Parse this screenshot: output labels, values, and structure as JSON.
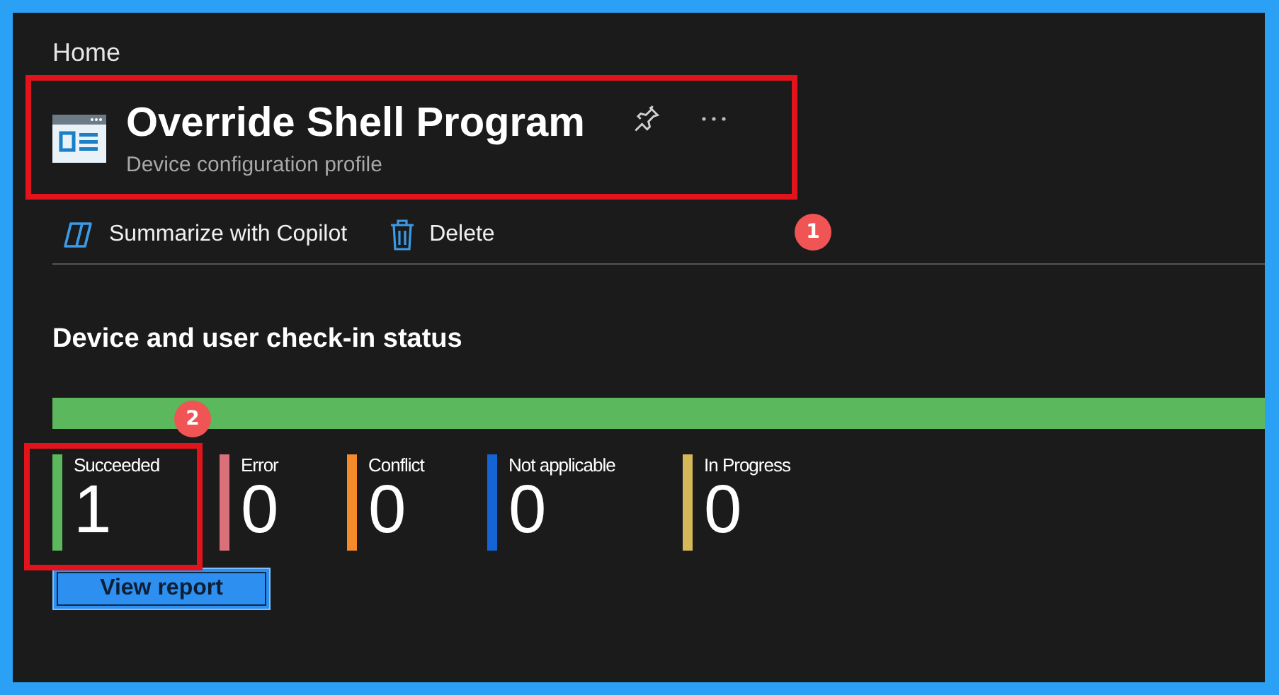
{
  "breadcrumb": "Home",
  "header": {
    "title": "Override Shell Program",
    "subtitle": "Device configuration profile",
    "pinned": false
  },
  "toolbar": [
    {
      "kind": "copilot",
      "label": "Summarize with Copilot"
    },
    {
      "kind": "delete",
      "label": "Delete"
    }
  ],
  "status": {
    "title": "Device and user check-in status",
    "level": 1,
    "tiles": [
      {
        "label": "Succeeded",
        "value": "1",
        "color": "#5cb85c"
      },
      {
        "label": "Error",
        "value": "0",
        "color": "#d9707a"
      },
      {
        "label": "Conflict",
        "value": "0",
        "color": "#f58a2a"
      },
      {
        "label": "Not applicable",
        "value": "0",
        "color": "#1564d6"
      },
      {
        "label": "In Progress",
        "value": "0",
        "color": "#d4b85a"
      }
    ],
    "button": "View report"
  },
  "annotations": [
    "1",
    "2"
  ]
}
